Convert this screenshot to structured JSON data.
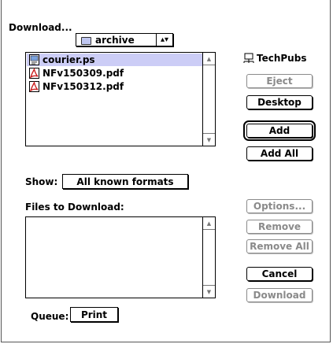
{
  "dialog": {
    "title": "Download...",
    "folder_popup": {
      "label": "archive",
      "icon": "folder-icon",
      "arrows": "⬍"
    },
    "volume": {
      "label": "TechPubs",
      "icon": "network-volume-icon"
    }
  },
  "file_list": [
    {
      "name": "courier.ps",
      "icon": "postscript-file-icon",
      "selected": true
    },
    {
      "name": "NFv150309.pdf",
      "icon": "pdf-file-icon",
      "selected": false
    },
    {
      "name": "NFv150312.pdf",
      "icon": "pdf-file-icon",
      "selected": false
    }
  ],
  "buttons": {
    "eject": "Eject",
    "desktop": "Desktop",
    "add": "Add",
    "add_all": "Add All",
    "options": "Options...",
    "remove": "Remove",
    "remove_all": "Remove All",
    "cancel": "Cancel",
    "download": "Download"
  },
  "show": {
    "label": "Show:",
    "value": "All known formats"
  },
  "files_to_download": {
    "label": "Files to Download:",
    "items": []
  },
  "queue": {
    "label": "Queue:",
    "value": "Print"
  },
  "colors": {
    "selection": "#cccdf6",
    "disabled_text": "#8a8a8a",
    "pdf_red": "#cc2222"
  }
}
